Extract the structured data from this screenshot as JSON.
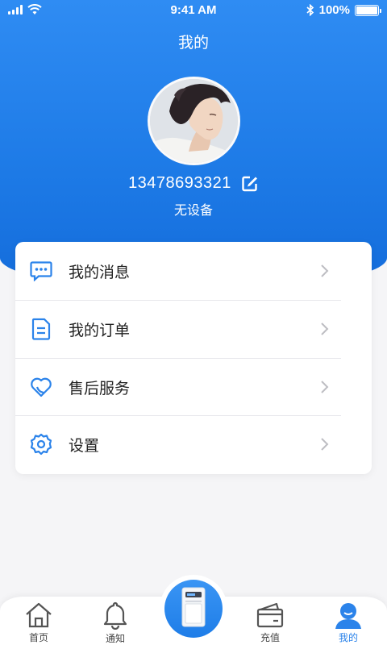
{
  "status_bar": {
    "time": "9:41 AM",
    "battery_text": "100%",
    "battery_level": 1.0,
    "icons": [
      "signal-icon",
      "wifi-icon",
      "bluetooth-icon",
      "battery-icon"
    ]
  },
  "header": {
    "title": "我的"
  },
  "profile": {
    "avatar_icon": "avatar",
    "phone": "13478693321",
    "edit_icon": "edit-icon",
    "device_status": "无设备"
  },
  "menu": {
    "items": [
      {
        "label": "我的消息",
        "icon": "message-icon"
      },
      {
        "label": "我的订单",
        "icon": "order-icon"
      },
      {
        "label": "售后服务",
        "icon": "heart-icon"
      },
      {
        "label": "设置",
        "icon": "settings-icon"
      }
    ]
  },
  "tabbar": {
    "tabs": [
      {
        "label": "首页",
        "icon": "home-icon"
      },
      {
        "label": "通知",
        "icon": "bell-icon"
      },
      {
        "label": "充值",
        "icon": "wallet-icon"
      },
      {
        "label": "我的",
        "icon": "user-icon"
      }
    ],
    "active_tab": "我的",
    "center_icon": "device-icon"
  },
  "colors": {
    "primary": "#2b83ea",
    "hero_top": "#2f8cf3",
    "hero_bottom": "#146cdb",
    "background": "#f5f5f7",
    "text": "#222222"
  }
}
